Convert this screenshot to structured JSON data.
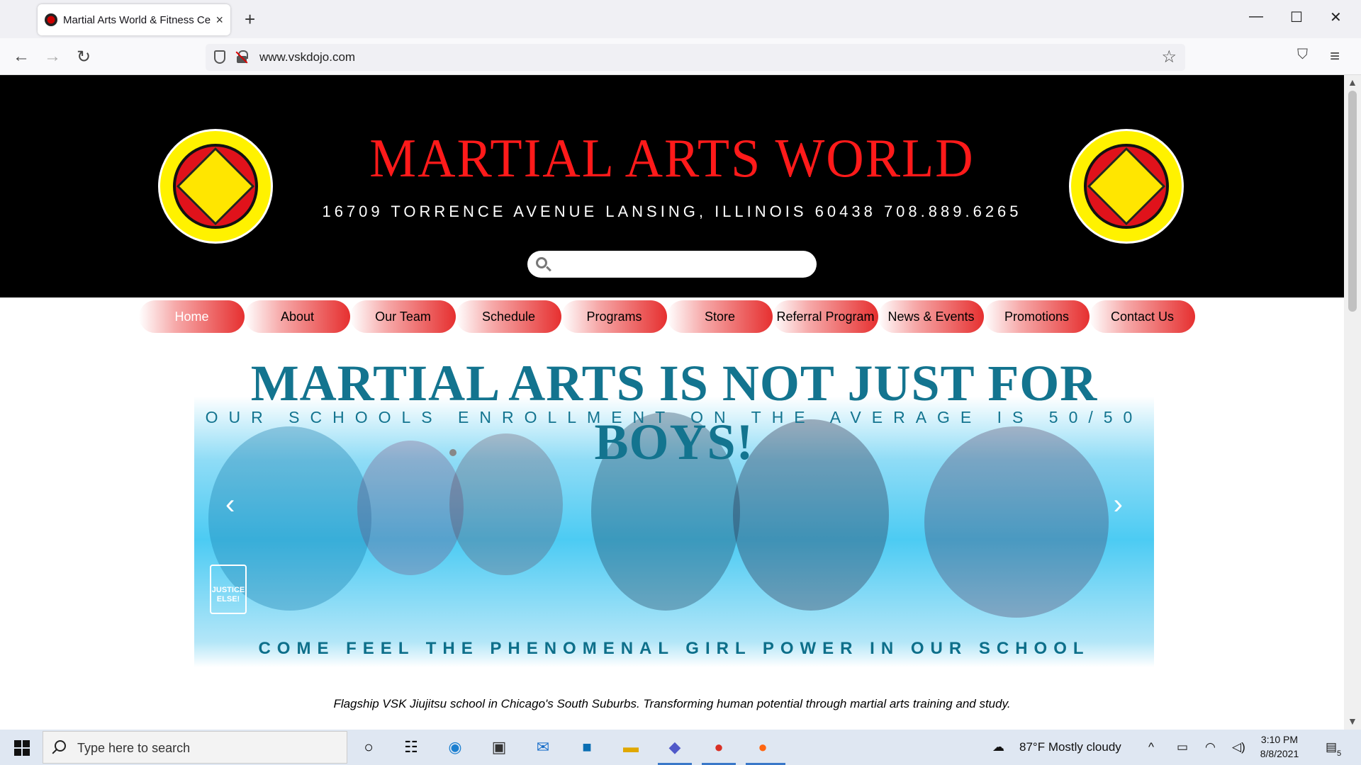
{
  "browser": {
    "tab_title": "Martial Arts World & Fitness Ce",
    "url": "www.vskdojo.com",
    "new_tab": "+",
    "close_tab": "×",
    "back": "←",
    "forward": "→",
    "reload": "↻",
    "bookmark_star": "☆",
    "pocket": "⛉",
    "menu": "≡",
    "minimize": "—",
    "maximize": "☐",
    "close": "✕"
  },
  "header": {
    "title": "MARTIAL ARTS WORLD",
    "address": "16709 TORRENCE AVENUE   LANSING, ILLINOIS 60438   708.889.6265",
    "logo_text": "MARTIAL ARTS WORLD",
    "search_placeholder": ""
  },
  "menu": {
    "items": [
      {
        "label": "Home",
        "active": true
      },
      {
        "label": "About"
      },
      {
        "label": "Our Team"
      },
      {
        "label": "Schedule"
      },
      {
        "label": "Programs"
      },
      {
        "label": "Store"
      },
      {
        "label": "Referral Program"
      },
      {
        "label": "News & Events"
      },
      {
        "label": "Promotions"
      },
      {
        "label": "Contact Us"
      }
    ]
  },
  "banner": {
    "headline": "MARTIAL ARTS IS NOT JUST FOR BOYS!",
    "subheadline": "OUR SCHOOLS ENROLLMENT ON THE AVERAGE IS 50/50",
    "footer": "COME FEEL THE PHENOMENAL GIRL POWER IN OUR SCHOOL",
    "badge": "JUSTICE ELSE!",
    "prev": "‹",
    "next": "›"
  },
  "tagline": "Flagship VSK Jiujitsu school in Chicago's South Suburbs. Transforming human potential through martial arts training and study.",
  "taskbar": {
    "search_placeholder": "Type here to search",
    "weather": "87°F  Mostly cloudy",
    "time": "3:10 PM",
    "date": "8/8/2021",
    "notifications": "5",
    "apps": [
      "cortana-icon",
      "task-view-icon",
      "edge-icon",
      "store-icon",
      "mail-icon",
      "dell-icon",
      "file-explorer-icon",
      "teams-icon",
      "chrome-icon",
      "firefox-icon"
    ]
  }
}
